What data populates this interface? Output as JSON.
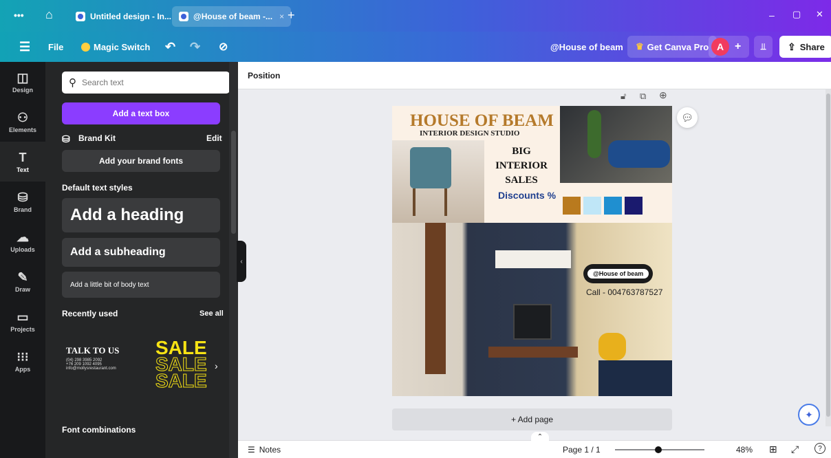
{
  "tabs": {
    "menu": "•••",
    "home": "⌂",
    "tab1": "Untitled design - In...",
    "tab2": "@House of beam -...",
    "close": "×",
    "new": "+"
  },
  "window": {
    "min": "–",
    "max": "▢",
    "close": "✕"
  },
  "toolbar": {
    "file": "File",
    "magic": "Magic Switch",
    "undo": "↶",
    "redo": "↷",
    "cloud": "⊘",
    "doc_name": "@House of beam",
    "pro": "Get Canva Pro",
    "avatar": "A",
    "add": "+",
    "stats": "⫫",
    "share": "Share"
  },
  "rail": [
    {
      "g": "◫",
      "l": "Design"
    },
    {
      "g": "⚇",
      "l": "Elements"
    },
    {
      "g": "T",
      "l": "Text"
    },
    {
      "g": "⛁",
      "l": "Brand"
    },
    {
      "g": "☁",
      "l": "Uploads"
    },
    {
      "g": "✎",
      "l": "Draw"
    },
    {
      "g": "▭",
      "l": "Projects"
    },
    {
      "g": "⁝⁝⁝",
      "l": "Apps"
    }
  ],
  "panel": {
    "search_placeholder": "Search text",
    "add_text_box": "Add a text box",
    "brand_kit": "Brand Kit",
    "edit": "Edit",
    "add_brand_fonts": "Add your brand fonts",
    "default_styles": "Default text styles",
    "heading": "Add a heading",
    "subheading": "Add a subheading",
    "body": "Add a little bit of body text",
    "recently_used": "Recently used",
    "see_all": "See all",
    "talk_title": "TALK TO US",
    "talk_l1": "(04) 298 3985 2092",
    "talk_l2": "+76 209 1092 4095",
    "talk_l3": "info@mollysrestaurant.com",
    "sale": "SALE",
    "font_combos": "Font combinations"
  },
  "canvas": {
    "position": "Position",
    "add_page": "+ Add page"
  },
  "design": {
    "title": "HOUSE OF BEAM",
    "subtitle": "INTERIOR DESIGN STUDIO",
    "big1": "BIG",
    "big2": "INTERIOR",
    "big3": "SALES",
    "discounts": "Discounts %",
    "handle": "@House of beam",
    "call": "Call - 004763787527",
    "swatches": [
      "#b97a1e",
      "#bfe6f7",
      "#1f8fd0",
      "#1a1a6e"
    ]
  },
  "footer": {
    "notes": "Notes",
    "page": "Page 1 / 1",
    "zoom": "48%"
  }
}
